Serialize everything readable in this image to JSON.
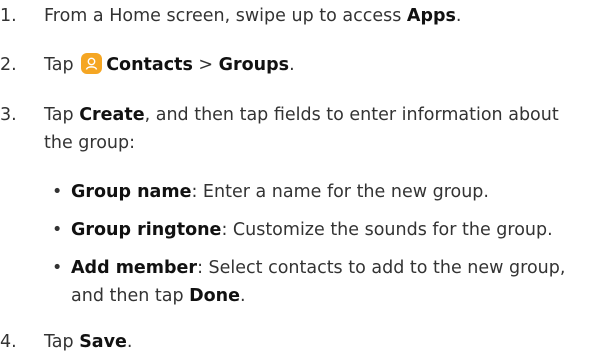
{
  "steps": [
    {
      "num": "1.",
      "pre": "From a Home screen, swipe up to access ",
      "bold": "Apps",
      "post": "."
    },
    {
      "num": "2.",
      "pre": "Tap ",
      "bold1": "Contacts",
      "sep": " > ",
      "bold2": "Groups",
      "post": ".",
      "icon": "contacts-app-icon"
    },
    {
      "num": "3.",
      "pre": "Tap ",
      "bold": "Create",
      "post": ", and then tap fields to enter information about",
      "line2": "the group:"
    },
    {
      "num": "4.",
      "pre": "Tap ",
      "bold": "Save",
      "post": "."
    }
  ],
  "bullets": [
    {
      "bold": "Group name",
      "text": ": Enter a name for the new group."
    },
    {
      "bold": "Group ringtone",
      "text": ": Customize the sounds for the group."
    },
    {
      "bold": "Add member",
      "text": ": Select contacts to add to the new group,",
      "line2_pre": "and then tap ",
      "line2_bold": "Done",
      "line2_post": "."
    }
  ],
  "bullet_char": "•",
  "colors": {
    "icon": "#f5a623",
    "text": "#333333"
  }
}
